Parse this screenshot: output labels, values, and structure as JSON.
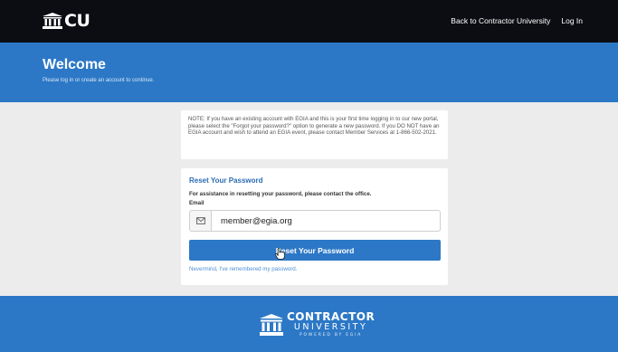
{
  "header": {
    "logo_text": "CU",
    "nav": [
      "Back to Contractor University",
      "Log In"
    ]
  },
  "hero": {
    "title": "Welcome",
    "subtitle": "Please log in or create an account to continue."
  },
  "notice": {
    "text": "NOTE: If you have an existing account with EGIA and this is your first time logging in to our new portal, please select the \"Forgot your password?\" option to generate a new password. If you DO NOT have an EGIA account and wish to attend an EGIA event, please contact Member Services at 1-866-502-2021."
  },
  "reset": {
    "title": "Reset Your Password",
    "help": "For assistance in resetting your password, please contact the office.",
    "email_label": "Email",
    "email_value": "member@egia.org",
    "button_label": "Reset Your Password",
    "nevermind": "Nevermind, I've remembered my password."
  },
  "footer": {
    "line1": "CONTRACTOR",
    "line2": "UNIVERSITY",
    "line3": "POWERED BY EGIA"
  },
  "colors": {
    "topbar": "#0b0d12",
    "brand_blue": "#2c78c6",
    "link_blue": "#4f8fd6",
    "background": "#ececec"
  },
  "icons": [
    "building-icon",
    "envelope-icon",
    "hand-cursor-icon"
  ]
}
